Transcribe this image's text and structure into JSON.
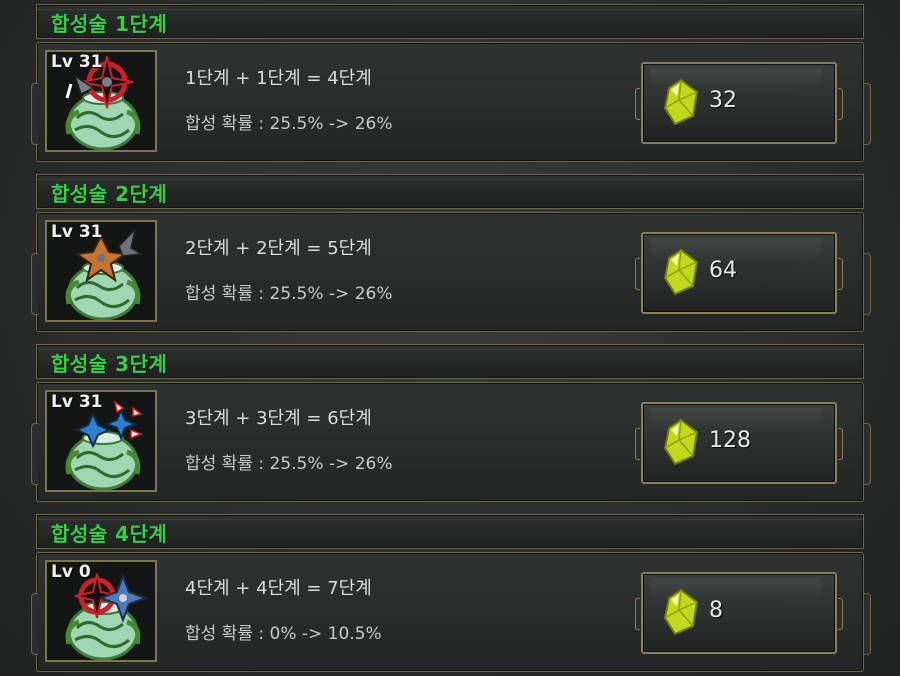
{
  "tiers": [
    {
      "title": "합성술 1단계",
      "level": "Lv 31",
      "formula": "1단계 + 1단계 = 4단계",
      "rate": "합성 확률 : 25.5% -> 26%",
      "cost": "32",
      "weapon_colors": [
        "#cc1f2a",
        "#7a7f86"
      ]
    },
    {
      "title": "합성술 2단계",
      "level": "Lv 31",
      "formula": "2단계 + 2단계 = 5단계",
      "rate": "합성 확률 : 25.5% -> 26%",
      "cost": "64",
      "weapon_colors": [
        "#c8732a",
        "#6f747a"
      ]
    },
    {
      "title": "합성술 3단계",
      "level": "Lv 31",
      "formula": "3단계 + 3단계 = 6단계",
      "rate": "합성 확률 : 25.5% -> 26%",
      "cost": "128",
      "weapon_colors": [
        "#2f7fd0",
        "#e8e8e8"
      ]
    },
    {
      "title": "합성술 4단계",
      "level": "Lv 0",
      "formula": "4단계 + 4단계 = 7단계",
      "rate": "합성 확률 : 0% -> 10.5%",
      "cost": "8",
      "weapon_colors": [
        "#cc1f2a",
        "#4f79b8"
      ]
    }
  ],
  "icons": {
    "item": "shuriken-egg-icon",
    "currency": "yellow-gem-icon"
  },
  "colors": {
    "title": "#35d04a",
    "border": "#6e6547",
    "gem": "#d6e82a"
  }
}
